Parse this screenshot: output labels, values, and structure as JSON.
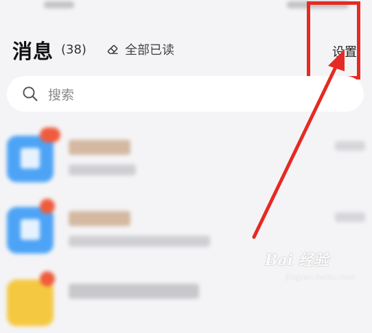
{
  "header": {
    "title": "消息",
    "unread_count": "(38)",
    "mark_all_read": "全部已读",
    "settings": "设置"
  },
  "search": {
    "placeholder": "搜索"
  },
  "icons": {
    "mark_read": "eraser-icon",
    "search": "search-icon"
  },
  "messages": [
    {
      "avatar_color": "#4da3f5",
      "badge_color": "#ef5b3c"
    },
    {
      "avatar_color": "#4da3f5",
      "badge_color": "#ef5b3c"
    },
    {
      "avatar_color": "#f5c842",
      "badge_color": "#ef5b3c"
    }
  ],
  "annotation": {
    "highlight_color": "#e52a24"
  },
  "watermark": {
    "main": "Bai 经验",
    "sub": "jingyan.baidu.com"
  }
}
